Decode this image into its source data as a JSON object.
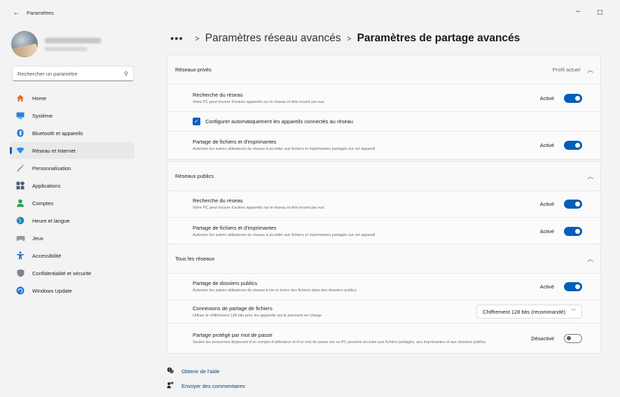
{
  "window": {
    "title": "Paramètres",
    "back_glyph": "←",
    "minimize_glyph": "–",
    "maximize_glyph": "▢"
  },
  "sidebar": {
    "search_placeholder": "Rechercher un paramètre",
    "items": [
      {
        "label": "Home",
        "icon": "home-icon",
        "color": "#e06a2a",
        "active": false
      },
      {
        "label": "Système",
        "icon": "system-icon",
        "color": "#2b7fd8",
        "active": false
      },
      {
        "label": "Bluetooth et appareils",
        "icon": "bluetooth-icon",
        "color": "#1f6fd6",
        "active": false
      },
      {
        "label": "Réseau et Internet",
        "icon": "network-icon",
        "color": "#2c8ef0",
        "active": true
      },
      {
        "label": "Personnalisation",
        "icon": "brush-icon",
        "color": "#d86a2c",
        "active": false
      },
      {
        "label": "Applications",
        "icon": "apps-icon",
        "color": "#4a5a73",
        "active": false
      },
      {
        "label": "Comptes",
        "icon": "account-icon",
        "color": "#2e9e52",
        "active": false
      },
      {
        "label": "Heure et langue",
        "icon": "globe-icon",
        "color": "#2583c9",
        "active": false
      },
      {
        "label": "Jeux",
        "icon": "gamepad-icon",
        "color": "#8e9aa6",
        "active": false
      },
      {
        "label": "Accessibilité",
        "icon": "accessibility-icon",
        "color": "#1d68c7",
        "active": false
      },
      {
        "label": "Confidentialité et sécurité",
        "icon": "shield-icon",
        "color": "#7b8490",
        "active": false
      },
      {
        "label": "Windows Update",
        "icon": "update-icon",
        "color": "#1c72cf",
        "active": false
      }
    ]
  },
  "breadcrumb": {
    "dots": "•••",
    "parent": "Paramètres réseau avancés",
    "current": "Paramètres de partage avancés"
  },
  "sections": {
    "private": {
      "title": "Réseaux privés",
      "meta": "Profil actuel",
      "discovery": {
        "label": "Recherche du réseau",
        "desc": "Votre PC peut trouver d'autres appareils sur le réseau et être trouvé par eux",
        "state": "Activé"
      },
      "auto_config": {
        "label": "Configurer automatiquement les appareils connectés au réseau"
      },
      "file_sharing": {
        "label": "Partage de fichiers et d'imprimantes",
        "desc": "Autoriser les autres utilisateurs du réseau à accéder aux fichiers et imprimantes partagés sur cet appareil",
        "state": "Activé"
      }
    },
    "public": {
      "title": "Réseaux publics",
      "discovery": {
        "label": "Recherche du réseau",
        "desc": "Votre PC peut trouver d'autres appareils sur le réseau et être trouvé par eux",
        "state": "Activé"
      },
      "file_sharing": {
        "label": "Partage de fichiers et d'imprimantes",
        "desc": "Autoriser les autres utilisateurs du réseau à accéder aux fichiers et imprimantes partagés sur cet appareil",
        "state": "Activé"
      }
    },
    "all": {
      "title": "Tous les réseaux",
      "public_folders": {
        "label": "Partage de dossiers publics",
        "desc": "Autoriser les autres utilisateurs du réseau à lire et écrire des fichiers dans des dossiers publics",
        "state": "Activé"
      },
      "connections": {
        "label": "Connexions de partage de fichiers",
        "desc": "Utiliser le chiffrement 128 bits pour les appareils qui le prennent en charge",
        "selected": "Chiffrement 128 bits (recommandé)"
      },
      "password": {
        "label": "Partage protégé par mot de passe",
        "desc": "Seules les personnes disposant d'un compte d'utilisateur et d'un mot de passe sur ce PC peuvent accéder aux fichiers partagés, aux imprimantes et aux dossiers publics",
        "state": "Désactivé"
      }
    }
  },
  "footer": {
    "help": "Obtenir de l'aide",
    "feedback": "Envoyer des commentaires"
  },
  "colors": {
    "accent": "#005fb8",
    "link": "#003e92"
  }
}
